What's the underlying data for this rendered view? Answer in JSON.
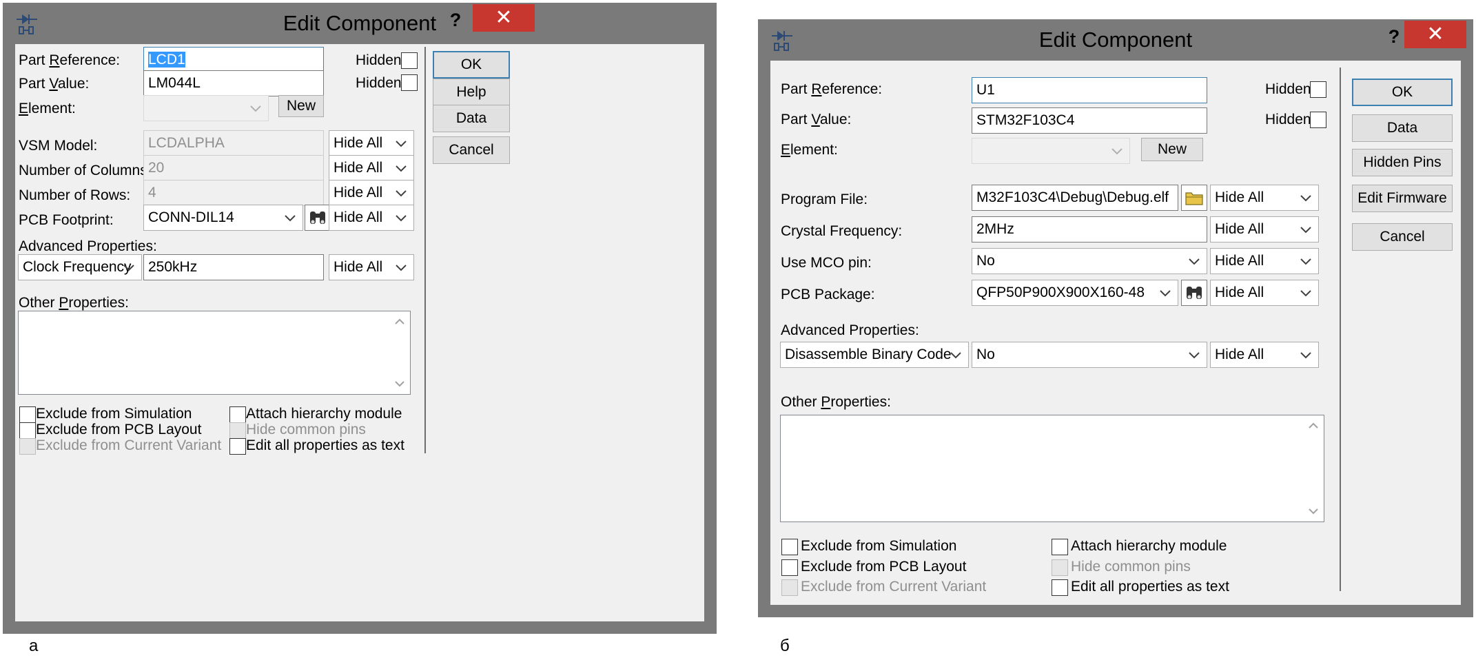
{
  "dialog_a": {
    "title": "Edit Component",
    "help": "?",
    "close": "✕",
    "part_reference": {
      "label_pre": "Part ",
      "label_u": "R",
      "label_post": "eference:",
      "value": "LCD1",
      "hidden_label": "Hidden:"
    },
    "part_value": {
      "label_pre": "Part ",
      "label_u": "V",
      "label_post": "alue:",
      "value": "LM044L",
      "hidden_label": "Hidden:"
    },
    "element": {
      "label_u": "E",
      "label_post": "lement:",
      "value": "",
      "new_button": "New"
    },
    "vsm_model": {
      "label": "VSM Model:",
      "value": "LCDALPHA",
      "visibility": "Hide All"
    },
    "columns": {
      "label": "Number of Columns:",
      "value": "20",
      "visibility": "Hide All"
    },
    "rows": {
      "label": "Number of Rows:",
      "value": "4",
      "visibility": "Hide All"
    },
    "pcb_footprint": {
      "label": "PCB Footprint:",
      "value": "CONN-DIL14",
      "visibility": "Hide All"
    },
    "advanced": {
      "label": "Advanced Properties:",
      "property": "Clock Frequency",
      "value": "250kHz",
      "visibility": "Hide All"
    },
    "other": {
      "label_pre": "Other ",
      "label_u": "P",
      "label_post": "roperties:"
    },
    "buttons": {
      "ok": "OK",
      "help": "Help",
      "data": "Data",
      "cancel": "Cancel"
    },
    "checks": {
      "exclude_sim": "Exclude from Simulation",
      "exclude_pcb": "Exclude from PCB Layout",
      "exclude_variant": "Exclude from Current Variant",
      "attach": "Attach hierarchy module",
      "hide_pins": "Hide common pins",
      "edit_text": "Edit all properties as text"
    },
    "caption": "а"
  },
  "dialog_b": {
    "title": "Edit Component",
    "help": "?",
    "close": "✕",
    "part_reference": {
      "label_pre": "Part ",
      "label_u": "R",
      "label_post": "eference:",
      "value": "U1",
      "hidden_label": "Hidden:"
    },
    "part_value": {
      "label_pre": "Part ",
      "label_u": "V",
      "label_post": "alue:",
      "value": "STM32F103C4",
      "hidden_label": "Hidden:"
    },
    "element": {
      "label_u": "E",
      "label_post": "lement:",
      "value": "",
      "new_button": "New"
    },
    "program_file": {
      "label": "Program File:",
      "value": "M32F103C4\\Debug\\Debug.elf",
      "visibility": "Hide All"
    },
    "crystal": {
      "label": "Crystal Frequency:",
      "value": "2MHz",
      "visibility": "Hide All"
    },
    "mco": {
      "label": "Use MCO pin:",
      "value": "No",
      "visibility": "Hide All"
    },
    "pcb_package": {
      "label": "PCB Package:",
      "value": "QFP50P900X900X160-48",
      "visibility": "Hide All"
    },
    "advanced": {
      "label": "Advanced Properties:",
      "property": "Disassemble Binary Code",
      "value": "No",
      "visibility": "Hide All"
    },
    "other": {
      "label_pre": "Other ",
      "label_u": "P",
      "label_post": "roperties:"
    },
    "buttons": {
      "ok": "OK",
      "data": "Data",
      "hidden_pins": "Hidden Pins",
      "edit_firmware": "Edit Firmware",
      "cancel": "Cancel"
    },
    "checks": {
      "exclude_sim": "Exclude from Simulation",
      "exclude_pcb": "Exclude from PCB Layout",
      "exclude_variant": "Exclude from Current Variant",
      "attach": "Attach hierarchy module",
      "hide_pins": "Hide common pins",
      "edit_text": "Edit all properties as text"
    },
    "caption": "б"
  }
}
